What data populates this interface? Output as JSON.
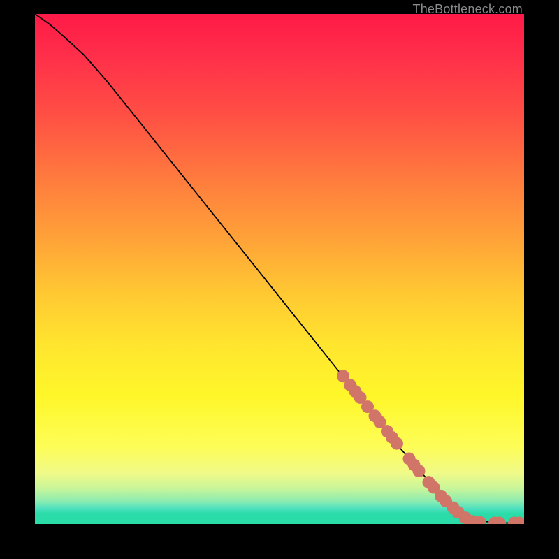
{
  "watermark": "TheBottleneck.com",
  "chart_data": {
    "type": "line",
    "title": "",
    "xlabel": "",
    "ylabel": "",
    "xlim": [
      0,
      100
    ],
    "ylim": [
      0,
      100
    ],
    "x": [
      0,
      3,
      6,
      10,
      15,
      20,
      25,
      30,
      35,
      40,
      45,
      50,
      55,
      60,
      65,
      70,
      75,
      80,
      85,
      88,
      90,
      92,
      94,
      96,
      98,
      100
    ],
    "y": [
      100,
      98,
      95.5,
      92,
      86.5,
      80.5,
      74.5,
      68.5,
      62.5,
      56.5,
      50.5,
      44.5,
      38.5,
      32.5,
      26.5,
      20.5,
      14.5,
      9,
      4,
      2,
      1,
      0.5,
      0.3,
      0.2,
      0.2,
      0.2
    ],
    "markers": [
      {
        "x": 63,
        "y": 29
      },
      {
        "x": 64.5,
        "y": 27.2
      },
      {
        "x": 65.5,
        "y": 26
      },
      {
        "x": 66.5,
        "y": 24.8
      },
      {
        "x": 68,
        "y": 23
      },
      {
        "x": 69.5,
        "y": 21.2
      },
      {
        "x": 70.5,
        "y": 20
      },
      {
        "x": 72,
        "y": 18.2
      },
      {
        "x": 73,
        "y": 17
      },
      {
        "x": 74,
        "y": 15.8
      },
      {
        "x": 76.5,
        "y": 12.8
      },
      {
        "x": 77.5,
        "y": 11.6
      },
      {
        "x": 78.5,
        "y": 10.4
      },
      {
        "x": 80.5,
        "y": 8.2
      },
      {
        "x": 81.5,
        "y": 7.2
      },
      {
        "x": 83,
        "y": 5.5
      },
      {
        "x": 84,
        "y": 4.5
      },
      {
        "x": 85.5,
        "y": 3.2
      },
      {
        "x": 86.5,
        "y": 2.3
      },
      {
        "x": 88,
        "y": 1.2
      },
      {
        "x": 89.5,
        "y": 0.5
      },
      {
        "x": 91,
        "y": 0.3
      },
      {
        "x": 94,
        "y": 0.2
      },
      {
        "x": 95,
        "y": 0.2
      },
      {
        "x": 98,
        "y": 0.2
      },
      {
        "x": 99,
        "y": 0.2
      }
    ],
    "marker_color": "#d07568",
    "line_color": "#000000"
  }
}
